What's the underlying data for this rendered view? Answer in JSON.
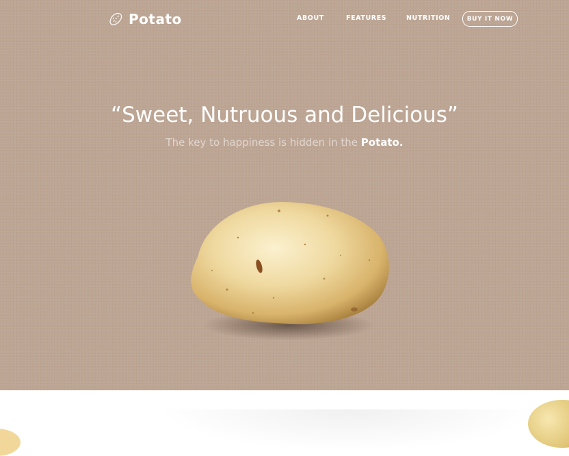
{
  "nav": {
    "brand": "Potato",
    "links": [
      "ABOUT",
      "FEATURES",
      "NUTRITION"
    ],
    "cta": "BUY IT NOW"
  },
  "hero": {
    "headline": "“Sweet, Nutruous and Delicious”",
    "tagline_prefix": "The key to happiness is hidden in the",
    "tagline_highlight": "Potato."
  },
  "colors": {
    "hero_background": "#bda594",
    "text": "#ffffff",
    "below_background": "#ffffff"
  },
  "icons": {
    "logo": "potato-icon"
  }
}
